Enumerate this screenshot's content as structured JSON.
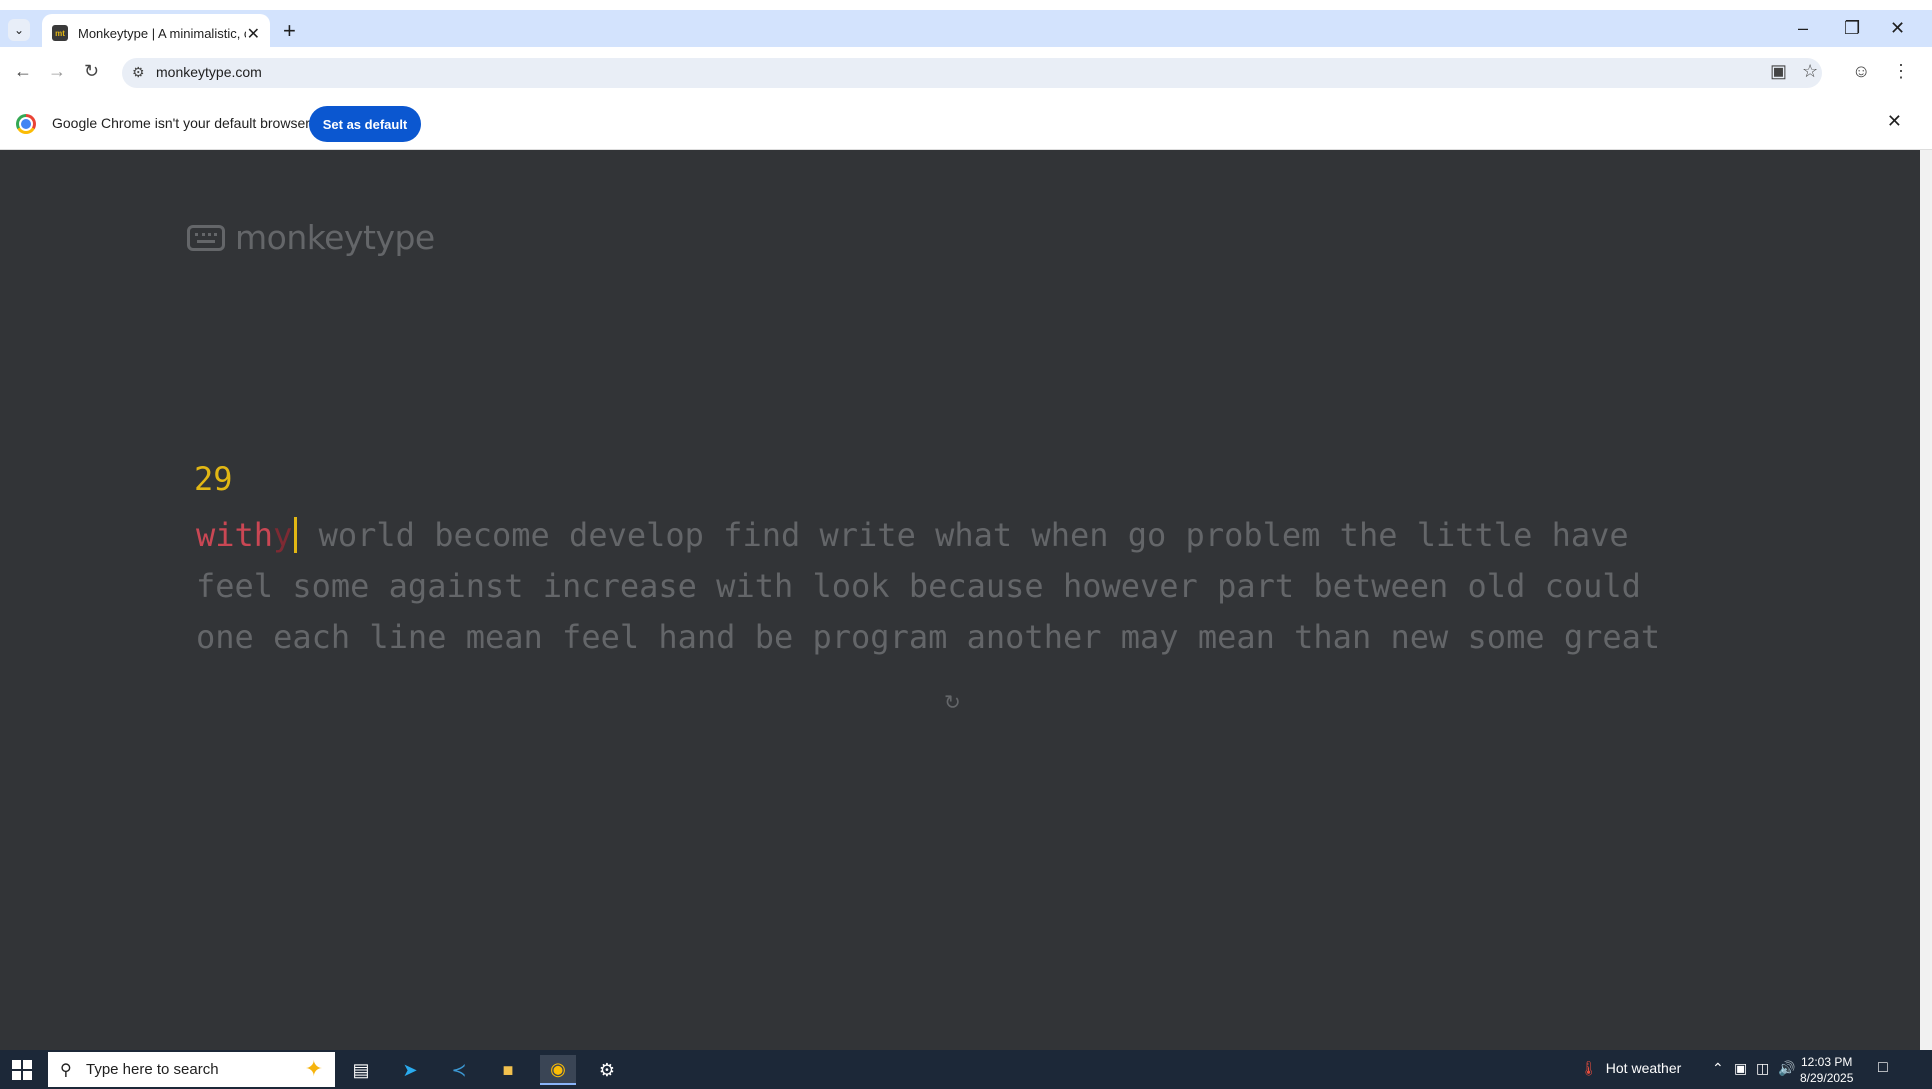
{
  "browser": {
    "tab": {
      "favicon_text": "mt",
      "title": "Monkeytype | A minimalistic, cu"
    },
    "url": "monkeytype.com",
    "infobar": {
      "message": "Google Chrome isn't your default browser",
      "button": "Set as default"
    }
  },
  "page": {
    "logo_text": "monkeytype",
    "word_counter": "29",
    "typed_correct": "with",
    "typed_extra": "y",
    "line1_rest": "world become develop find write what when go problem the little have",
    "line2": "feel some against increase with look because however part between old could",
    "line3": "one each line mean feel hand be program another may mean than new some great",
    "colors": {
      "background": "#323437",
      "main": "#e2b714",
      "text": "#646669",
      "error": "#ca4754"
    }
  },
  "taskbar": {
    "search_placeholder": "Type here to search",
    "weather": "Hot weather",
    "time": "12:03 PM",
    "date": "8/29/2025",
    "apps": [
      "task-view",
      "telegram",
      "vscode",
      "file-explorer",
      "chrome",
      "steam"
    ]
  }
}
